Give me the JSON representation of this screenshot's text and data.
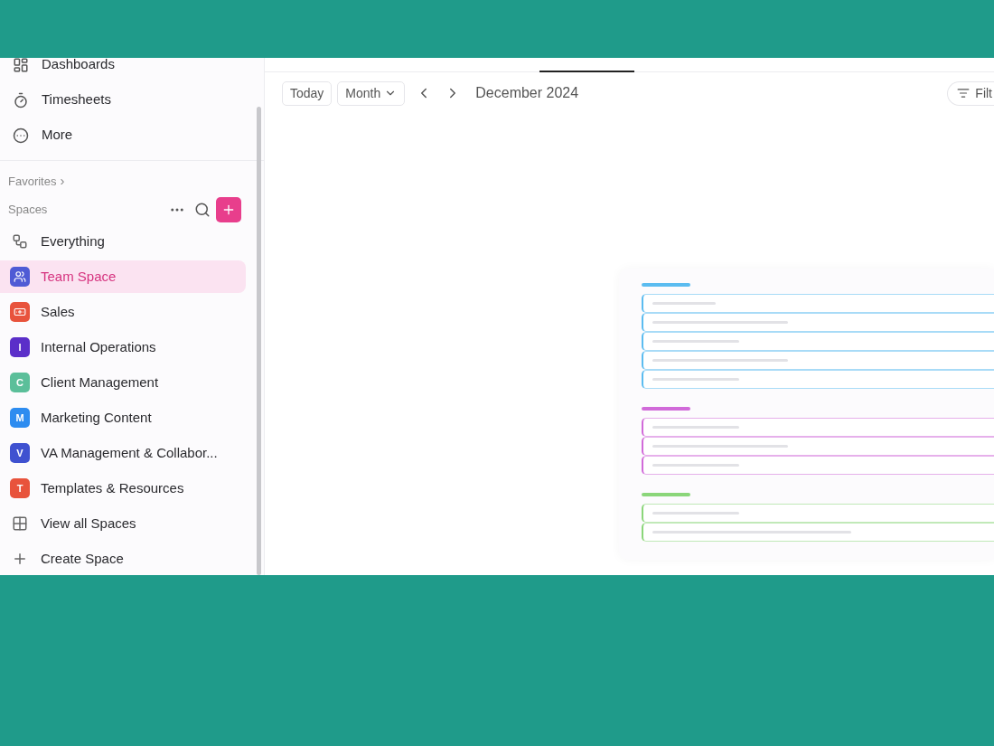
{
  "sidebar": {
    "nav_items": [
      {
        "label": "Dashboards",
        "kind": "dashboard"
      },
      {
        "label": "Timesheets",
        "kind": "timer"
      },
      {
        "label": "More",
        "kind": "more"
      }
    ],
    "favorites": {
      "label": "Favorites",
      "chevron": "›"
    },
    "spaces": {
      "label": "Spaces",
      "items": [
        {
          "label": "Everything",
          "kind": "everything",
          "selected": false
        },
        {
          "label": "Team Space",
          "kind": "team",
          "color": "#4f5bd5",
          "selected": true
        },
        {
          "label": "Sales",
          "kind": "sales",
          "color": "#e8533c",
          "selected": false
        },
        {
          "label": "Internal Operations",
          "kind": "letter",
          "letter": "I",
          "color": "#5b2fc9",
          "selected": false
        },
        {
          "label": "Client Management",
          "kind": "letter",
          "letter": "C",
          "color": "#5bbf9a",
          "selected": false
        },
        {
          "label": "Marketing Content",
          "kind": "letter",
          "letter": "M",
          "color": "#2d8cf0",
          "selected": false
        },
        {
          "label": "VA Management & Collabor...",
          "kind": "letter",
          "letter": "V",
          "color": "#3f51d0",
          "selected": false
        },
        {
          "label": "Templates & Resources",
          "kind": "letter",
          "letter": "T",
          "color": "#e8533c",
          "selected": false
        },
        {
          "label": "View all Spaces",
          "kind": "grid",
          "selected": false
        },
        {
          "label": "Create Space",
          "kind": "plus",
          "selected": false
        }
      ]
    }
  },
  "toolbar": {
    "today": "Today",
    "view": "Month",
    "period": "December 2024",
    "filter": "Filt"
  },
  "skeleton_groups": [
    {
      "color": "#5bbcf0"
    },
    {
      "color": "#d16ad9"
    },
    {
      "color": "#8bd67a"
    }
  ]
}
